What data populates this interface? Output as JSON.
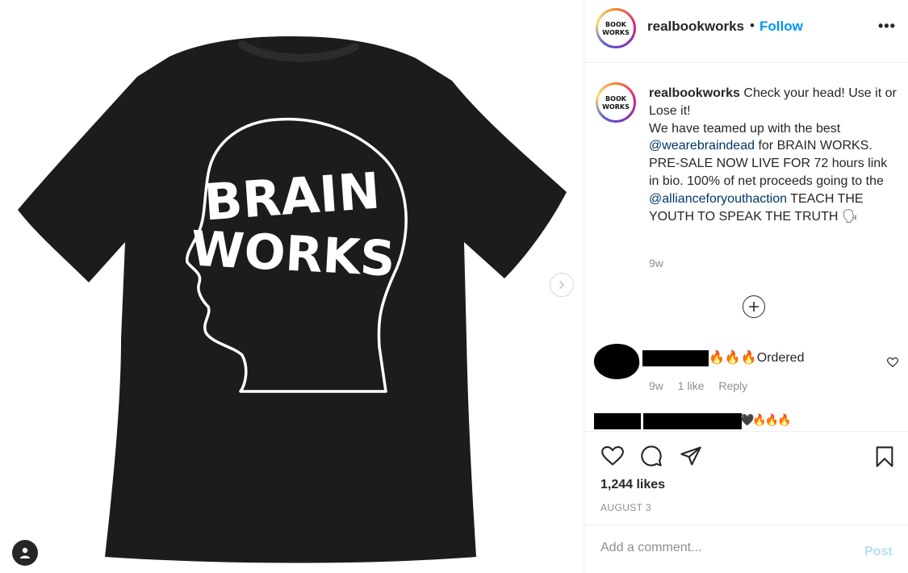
{
  "post": {
    "username": "realbookworks",
    "separator": "•",
    "follow_label": "Follow",
    "more_label": "•••",
    "avatar_text_line1": "BOOK",
    "avatar_text_line2": "WORKS"
  },
  "media": {
    "print_line1": "BRAIN",
    "print_line2": "WORKS"
  },
  "caption": {
    "username": "realbookworks",
    "seg1": " Check your head! Use it or Lose it!",
    "seg2": "We have teamed up with the best",
    "mention1": "@wearebraindead",
    "seg3": " for BRAIN WORKS. PRE-SALE NOW LIVE FOR 72 hours link in bio. 100% of net proceeds going to the",
    "mention2": "@allianceforyouthaction",
    "seg4": " TEACH THE YOUTH TO SPEAK THE TRUTH",
    "emoji": "🗣",
    "time": "9w"
  },
  "comments": [
    {
      "emoji": "🔥🔥🔥",
      "text": "Ordered",
      "time": "9w",
      "likes": "1 like",
      "reply": "Reply"
    },
    {
      "emoji": "🖤🔥🔥🔥"
    }
  ],
  "stats": {
    "likes": "1,244 likes",
    "date": "AUGUST 3"
  },
  "add_comment": {
    "placeholder": "Add a comment...",
    "post_label": "Post"
  },
  "icons": {
    "like": "heart-icon",
    "comment": "comment-icon",
    "share": "paper-plane-icon",
    "save": "bookmark-icon",
    "next": "chevron-right-icon",
    "tags": "user-tag-icon",
    "load_more": "plus-circle-icon"
  },
  "colors": {
    "accent": "#0095f6",
    "mention": "#00376b",
    "muted": "#8e8e8e",
    "post_disabled": "#b2dffc",
    "shirt": "#1c1c1c"
  }
}
